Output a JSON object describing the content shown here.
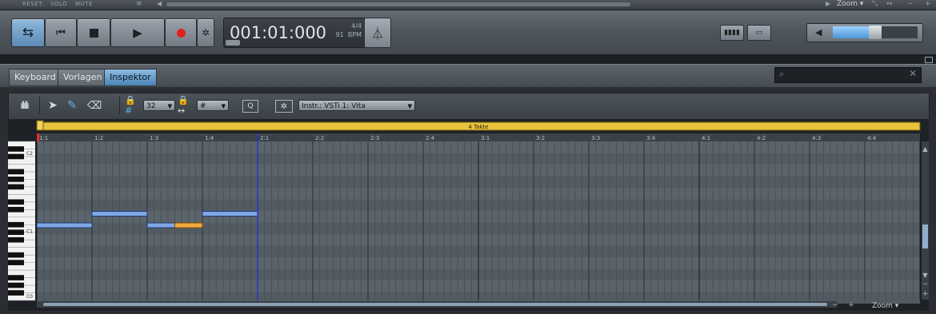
{
  "top_strip": {
    "reset": "RESET:",
    "solo": "SOLO",
    "mute": "MUTE",
    "zoom": "Zoom ▾"
  },
  "transport": {
    "time": "001:01:000",
    "time_signature": "4/4",
    "tempo": "91",
    "tempo_unit": "BPM",
    "volume_level": 0.5
  },
  "tabs": [
    {
      "label": "Keyboard",
      "active": false
    },
    {
      "label": "Vorlagen",
      "active": false
    },
    {
      "label": "Inspektor",
      "active": true
    }
  ],
  "toolbar": {
    "quantize_value": "32",
    "length_value": "#",
    "quantize_button": "Q",
    "instrument": "Instr.: VSTi 1: Vita"
  },
  "editor": {
    "loop_label": "4 Takte",
    "bar_labels": [
      "1:1",
      "1:2",
      "1:3",
      "1:4",
      "2:1",
      "2:2",
      "2:3",
      "2:4",
      "3:1",
      "3:2",
      "3:3",
      "3:4",
      "4:1",
      "4:2",
      "4:3",
      "4:4"
    ],
    "key_labels": [
      "C2",
      "C1",
      "C0"
    ],
    "zoom_label": "Zoom"
  },
  "notes": [
    {
      "beat": 0,
      "length": 1,
      "row": 0,
      "selected": false
    },
    {
      "beat": 1,
      "length": 1,
      "row": 1,
      "selected": false
    },
    {
      "beat": 2,
      "length": 0.5,
      "row": 0,
      "selected": false
    },
    {
      "beat": 2.5,
      "length": 0.5,
      "row": 0,
      "selected": true
    },
    {
      "beat": 3,
      "length": 1,
      "row": 1,
      "selected": false
    }
  ],
  "colors": {
    "accent": "#5b93c8",
    "note": "#7fa7e6",
    "note_selected": "#f2a93b",
    "loop_bar": "#e7c23a",
    "playhead": "#2436c8"
  }
}
